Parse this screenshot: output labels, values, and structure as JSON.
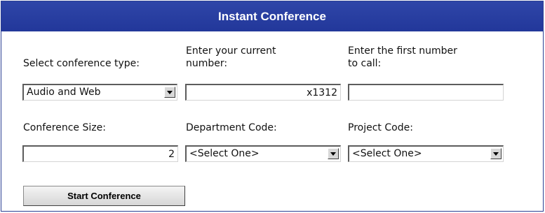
{
  "header": {
    "title": "Instant Conference"
  },
  "form": {
    "conference_type": {
      "label": "Select conference type:",
      "value": "Audio and Web"
    },
    "current_number": {
      "label": "Enter your current\nnumber:",
      "value": "x1312"
    },
    "first_number": {
      "label": "Enter the first number\nto call:",
      "value": ""
    },
    "conference_size": {
      "label": "Conference Size:",
      "value": "2"
    },
    "department_code": {
      "label": "Department Code:",
      "value": "<Select One>"
    },
    "project_code": {
      "label": "Project Code:",
      "value": "<Select One>"
    }
  },
  "actions": {
    "start_label": "Start Conference"
  },
  "colors": {
    "header_bg": "#2b3f9f",
    "border": "#2b3f93"
  },
  "icons": {
    "dropdown": "chevron-down-icon"
  }
}
